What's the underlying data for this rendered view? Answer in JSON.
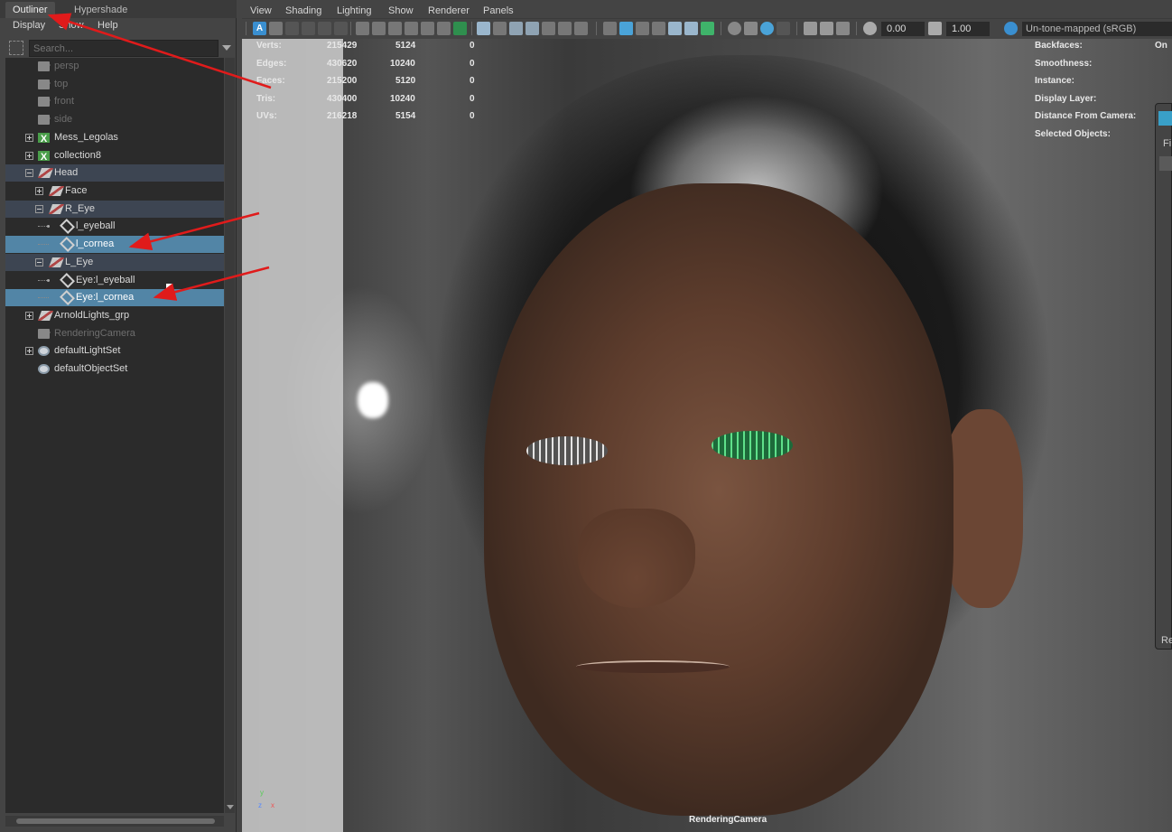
{
  "outliner": {
    "tabs": [
      "Outliner",
      "Hypershade"
    ],
    "menu": [
      "Display",
      "Show",
      "Help"
    ],
    "search_placeholder": "Search...",
    "items": [
      {
        "label": "persp",
        "icon": "camera-icon"
      },
      {
        "label": "top",
        "icon": "camera-icon"
      },
      {
        "label": "front",
        "icon": "camera-icon"
      },
      {
        "label": "side",
        "icon": "camera-icon"
      },
      {
        "label": "Mess_Legolas",
        "icon": "set-icon"
      },
      {
        "label": "collection8",
        "icon": "set-icon"
      },
      {
        "label": "Head",
        "icon": "transform-icon"
      },
      {
        "label": "Face",
        "icon": "transform-icon"
      },
      {
        "label": "R_Eye",
        "icon": "transform-icon"
      },
      {
        "label": "l_eyeball",
        "icon": "mesh-icon"
      },
      {
        "label": "l_cornea",
        "icon": "mesh-icon"
      },
      {
        "label": "L_Eye",
        "icon": "transform-icon"
      },
      {
        "label": "Eye:l_eyeball",
        "icon": "mesh-icon"
      },
      {
        "label": "Eye:l_cornea",
        "icon": "mesh-icon"
      },
      {
        "label": "ArnoldLights_grp",
        "icon": "transform-icon"
      },
      {
        "label": "RenderingCamera",
        "icon": "camera-icon"
      },
      {
        "label": "defaultLightSet",
        "icon": "object-set-icon"
      },
      {
        "label": "defaultObjectSet",
        "icon": "object-set-icon"
      }
    ]
  },
  "viewport": {
    "menu": [
      "View",
      "Shading",
      "Lighting",
      "Show",
      "Renderer",
      "Panels"
    ],
    "exposure": "0.00",
    "gamma": "1.00",
    "colorspace": "Un-tone-mapped (sRGB)",
    "hud_stats": [
      {
        "label": "Verts:",
        "a": "215429",
        "b": "5124",
        "c": "0"
      },
      {
        "label": "Edges:",
        "a": "430620",
        "b": "10240",
        "c": "0"
      },
      {
        "label": "Faces:",
        "a": "215200",
        "b": "5120",
        "c": "0"
      },
      {
        "label": "Tris:",
        "a": "430400",
        "b": "10240",
        "c": "0"
      },
      {
        "label": "UVs:",
        "a": "216218",
        "b": "5154",
        "c": "0"
      }
    ],
    "hud_right": [
      {
        "label": "Backfaces:",
        "value": "On"
      },
      {
        "label": "Smoothness:",
        "value": ""
      },
      {
        "label": "Instance:",
        "value": ""
      },
      {
        "label": "Display Layer:",
        "value": ""
      },
      {
        "label": "Distance From Camera:",
        "value": ""
      },
      {
        "label": "Selected Objects:",
        "value": ""
      }
    ],
    "camera_name": "RenderingCamera",
    "axis": {
      "x": "x",
      "y": "y",
      "z": "z"
    }
  },
  "side_window": {
    "letter_top": "Fi",
    "letter_bottom": "Re"
  },
  "colors": {
    "selected_row": "#5285a6",
    "group_row": "#3d4552",
    "annotation_arrow": "#e01b1b"
  }
}
